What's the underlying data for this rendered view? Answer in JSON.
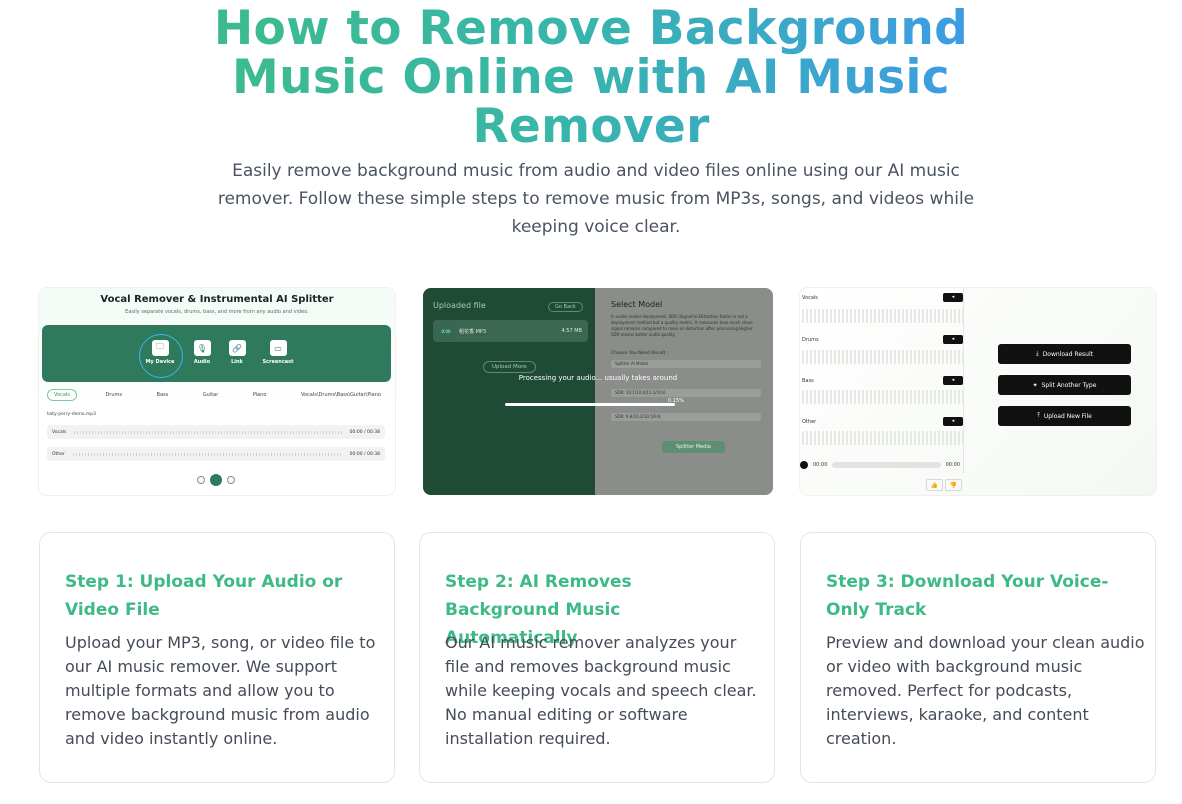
{
  "hero": {
    "title": "How to Remove Background Music Online with AI Music Remover",
    "subtitle": "Easily remove background music from audio and video files online using our AI music remover. Follow these simple steps to remove music from MP3s, songs, and videos while keeping voice clear."
  },
  "screenshot1": {
    "title": "Vocal Remover & Instrumental AI Splitter",
    "subtitle": "Easily separate vocals, drums, bass, and more from any audio and video.",
    "options": [
      {
        "label": "My Device",
        "icon": "folder-icon",
        "glyph": "🗀"
      },
      {
        "label": "Audio",
        "icon": "microphone-icon",
        "glyph": "🎙"
      },
      {
        "label": "Link",
        "icon": "link-icon",
        "glyph": "🔗"
      },
      {
        "label": "Screencast",
        "icon": "screen-icon",
        "glyph": "▭"
      }
    ],
    "tabs": [
      "Vocals",
      "Drums",
      "Bass",
      "Guitar",
      "Piano",
      "Vocals\\Drums\\Bass\\Guitar\\Piano"
    ],
    "file_name": "katy-perry-demo.mp3",
    "tracks": [
      {
        "name": "Vocals",
        "time": "00:00 / 00:38"
      },
      {
        "name": "Other",
        "time": "00:00 / 00:38"
      }
    ]
  },
  "screenshot2": {
    "uploaded_label": "Uploaded file",
    "go_back": "Go Back",
    "file_thumb": "0:00",
    "file_name": "稻花香.MP3",
    "file_size": "4.57 MB",
    "upload_more": "Upload More",
    "select_model": "Select Model",
    "description": "In audio model deployment, SDR (Signal-to-Distortion Ratio) is not a deployment method but a quality metric. It measures how much clean signal remains compared to noise or distortion after processing.Higher SDR means better audio quality.",
    "choose_label": "Choose You Need Result :",
    "model_options": [
      "Splitter AI Model",
      "SDR: 10.1/10.0/11.1/10.6",
      "SDR: 9.8/10.2/10.5/9.9"
    ],
    "split_button": "Splitter Media",
    "processing_text": "Processing your audio... usually takes around",
    "progress_percent": "0.15%",
    "progress": 0.0015
  },
  "screenshot3": {
    "tracks": [
      {
        "label": "Vocals"
      },
      {
        "label": "Drums"
      },
      {
        "label": "Bass"
      },
      {
        "label": "Other"
      }
    ],
    "buttons": [
      {
        "label": "Download Result",
        "icon": "download-icon",
        "glyph": "⤓"
      },
      {
        "label": "Split Another Type",
        "icon": "sparkle-icon",
        "glyph": "✦"
      },
      {
        "label": "Upload New File",
        "icon": "upload-icon",
        "glyph": "⤒"
      }
    ],
    "player_start": "00:00",
    "player_end": "00:00"
  },
  "steps": [
    {
      "title": "Step 1: Upload Your Audio or Video File",
      "body": "Upload your MP3, song, or video file to our AI music remover. We support multiple formats and allow you to remove background music from audio and video instantly online."
    },
    {
      "title": "Step 2: AI Removes Background Music Automatically",
      "body": "Our AI music remover analyzes your file and removes background music while keeping vocals and speech clear. No manual editing or software installation required."
    },
    {
      "title": "Step 3: Download Your Voice-Only Track",
      "body": "Preview and download your clean audio or video with background music removed. Perfect for podcasts, interviews, karaoke, and content creation."
    }
  ],
  "colors": {
    "accent_green": "#3dba86",
    "gradient_start": "#3dbb8c",
    "gradient_end": "#3d9be6",
    "panel_green": "#2f7a5c"
  }
}
